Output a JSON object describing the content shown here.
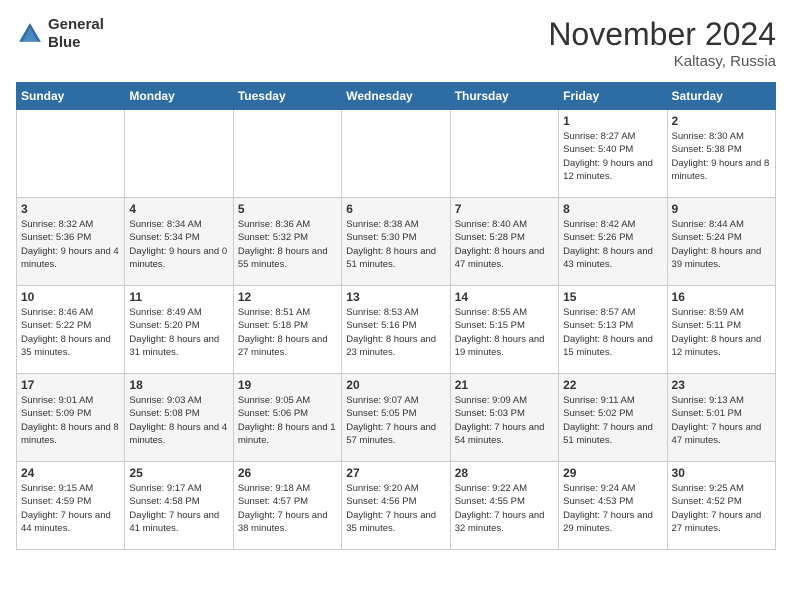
{
  "header": {
    "logo_line1": "General",
    "logo_line2": "Blue",
    "month": "November 2024",
    "location": "Kaltasy, Russia"
  },
  "days_of_week": [
    "Sunday",
    "Monday",
    "Tuesday",
    "Wednesday",
    "Thursday",
    "Friday",
    "Saturday"
  ],
  "weeks": [
    [
      {
        "num": "",
        "info": ""
      },
      {
        "num": "",
        "info": ""
      },
      {
        "num": "",
        "info": ""
      },
      {
        "num": "",
        "info": ""
      },
      {
        "num": "",
        "info": ""
      },
      {
        "num": "1",
        "info": "Sunrise: 8:27 AM\nSunset: 5:40 PM\nDaylight: 9 hours and 12 minutes."
      },
      {
        "num": "2",
        "info": "Sunrise: 8:30 AM\nSunset: 5:38 PM\nDaylight: 9 hours and 8 minutes."
      }
    ],
    [
      {
        "num": "3",
        "info": "Sunrise: 8:32 AM\nSunset: 5:36 PM\nDaylight: 9 hours and 4 minutes."
      },
      {
        "num": "4",
        "info": "Sunrise: 8:34 AM\nSunset: 5:34 PM\nDaylight: 9 hours and 0 minutes."
      },
      {
        "num": "5",
        "info": "Sunrise: 8:36 AM\nSunset: 5:32 PM\nDaylight: 8 hours and 55 minutes."
      },
      {
        "num": "6",
        "info": "Sunrise: 8:38 AM\nSunset: 5:30 PM\nDaylight: 8 hours and 51 minutes."
      },
      {
        "num": "7",
        "info": "Sunrise: 8:40 AM\nSunset: 5:28 PM\nDaylight: 8 hours and 47 minutes."
      },
      {
        "num": "8",
        "info": "Sunrise: 8:42 AM\nSunset: 5:26 PM\nDaylight: 8 hours and 43 minutes."
      },
      {
        "num": "9",
        "info": "Sunrise: 8:44 AM\nSunset: 5:24 PM\nDaylight: 8 hours and 39 minutes."
      }
    ],
    [
      {
        "num": "10",
        "info": "Sunrise: 8:46 AM\nSunset: 5:22 PM\nDaylight: 8 hours and 35 minutes."
      },
      {
        "num": "11",
        "info": "Sunrise: 8:49 AM\nSunset: 5:20 PM\nDaylight: 8 hours and 31 minutes."
      },
      {
        "num": "12",
        "info": "Sunrise: 8:51 AM\nSunset: 5:18 PM\nDaylight: 8 hours and 27 minutes."
      },
      {
        "num": "13",
        "info": "Sunrise: 8:53 AM\nSunset: 5:16 PM\nDaylight: 8 hours and 23 minutes."
      },
      {
        "num": "14",
        "info": "Sunrise: 8:55 AM\nSunset: 5:15 PM\nDaylight: 8 hours and 19 minutes."
      },
      {
        "num": "15",
        "info": "Sunrise: 8:57 AM\nSunset: 5:13 PM\nDaylight: 8 hours and 15 minutes."
      },
      {
        "num": "16",
        "info": "Sunrise: 8:59 AM\nSunset: 5:11 PM\nDaylight: 8 hours and 12 minutes."
      }
    ],
    [
      {
        "num": "17",
        "info": "Sunrise: 9:01 AM\nSunset: 5:09 PM\nDaylight: 8 hours and 8 minutes."
      },
      {
        "num": "18",
        "info": "Sunrise: 9:03 AM\nSunset: 5:08 PM\nDaylight: 8 hours and 4 minutes."
      },
      {
        "num": "19",
        "info": "Sunrise: 9:05 AM\nSunset: 5:06 PM\nDaylight: 8 hours and 1 minute."
      },
      {
        "num": "20",
        "info": "Sunrise: 9:07 AM\nSunset: 5:05 PM\nDaylight: 7 hours and 57 minutes."
      },
      {
        "num": "21",
        "info": "Sunrise: 9:09 AM\nSunset: 5:03 PM\nDaylight: 7 hours and 54 minutes."
      },
      {
        "num": "22",
        "info": "Sunrise: 9:11 AM\nSunset: 5:02 PM\nDaylight: 7 hours and 51 minutes."
      },
      {
        "num": "23",
        "info": "Sunrise: 9:13 AM\nSunset: 5:01 PM\nDaylight: 7 hours and 47 minutes."
      }
    ],
    [
      {
        "num": "24",
        "info": "Sunrise: 9:15 AM\nSunset: 4:59 PM\nDaylight: 7 hours and 44 minutes."
      },
      {
        "num": "25",
        "info": "Sunrise: 9:17 AM\nSunset: 4:58 PM\nDaylight: 7 hours and 41 minutes."
      },
      {
        "num": "26",
        "info": "Sunrise: 9:18 AM\nSunset: 4:57 PM\nDaylight: 7 hours and 38 minutes."
      },
      {
        "num": "27",
        "info": "Sunrise: 9:20 AM\nSunset: 4:56 PM\nDaylight: 7 hours and 35 minutes."
      },
      {
        "num": "28",
        "info": "Sunrise: 9:22 AM\nSunset: 4:55 PM\nDaylight: 7 hours and 32 minutes."
      },
      {
        "num": "29",
        "info": "Sunrise: 9:24 AM\nSunset: 4:53 PM\nDaylight: 7 hours and 29 minutes."
      },
      {
        "num": "30",
        "info": "Sunrise: 9:25 AM\nSunset: 4:52 PM\nDaylight: 7 hours and 27 minutes."
      }
    ]
  ]
}
